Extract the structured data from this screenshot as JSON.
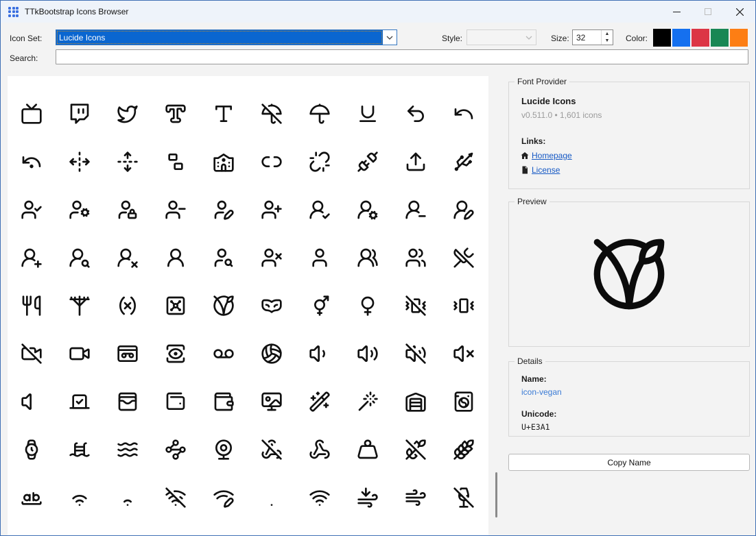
{
  "window": {
    "title": "TTkBootstrap Icons Browser"
  },
  "toolbar": {
    "icon_set_label": "Icon Set:",
    "icon_set_value": "Lucide Icons",
    "style_label": "Style:",
    "style_value": "",
    "size_label": "Size:",
    "size_value": "32",
    "color_label": "Color:",
    "colors": [
      "#000000",
      "#1570ef",
      "#dc3545",
      "#198754",
      "#fd7e14"
    ]
  },
  "search": {
    "label": "Search:",
    "value": "",
    "placeholder": ""
  },
  "grid": {
    "icons": [
      "tv",
      "twitch",
      "twitter",
      "type-outline",
      "type",
      "umbrella-off",
      "umbrella",
      "underline",
      "undo-2",
      "undo",
      "undo-dot",
      "unfold-horizontal",
      "unfold-vertical",
      "ungroup",
      "university",
      "unlink-2",
      "unlink",
      "unplug",
      "upload",
      "usb",
      "user-check",
      "user-cog",
      "user-lock",
      "user-minus",
      "user-pen",
      "user-plus",
      "user-round-check",
      "user-round-cog",
      "user-round-minus",
      "user-round-pen",
      "user-round-plus",
      "user-round-search",
      "user-round-x",
      "user-round",
      "user-search",
      "user-x",
      "user",
      "users-round",
      "users",
      "utensils-crossed",
      "utensils",
      "utility-pole",
      "variable",
      "vault",
      "vegan",
      "venetian-mask",
      "venus-and-mars",
      "venus",
      "vibrate-off",
      "vibrate",
      "video-off",
      "video",
      "videotape",
      "view",
      "voicemail",
      "volleyball",
      "volume-1",
      "volume-2",
      "volume-off",
      "volume-x",
      "volume",
      "vote",
      "wallet-cards",
      "wallet-minimal",
      "wallet",
      "wallpaper",
      "wand-sparkles",
      "wand",
      "warehouse",
      "washing-machine",
      "watch",
      "waves-ladder",
      "waves",
      "waypoints",
      "webcam",
      "webhook-off",
      "webhook",
      "weight",
      "wheat-off",
      "wheat",
      "whole-word",
      "wifi-high",
      "wifi-low",
      "wifi-off",
      "wifi-pen",
      "wifi-zero",
      "wifi",
      "wind-arrow-down",
      "wind",
      "wine-off"
    ]
  },
  "panel": {
    "font_provider": {
      "title": "Font Provider",
      "name": "Lucide Icons",
      "meta": "v0.511.0 • 1,601 icons",
      "links_label": "Links:",
      "links": [
        {
          "icon": "home-icon",
          "label": "Homepage"
        },
        {
          "icon": "license-file-icon",
          "label": "License"
        }
      ]
    },
    "preview": {
      "title": "Preview",
      "icon": "vegan"
    },
    "details": {
      "title": "Details",
      "name_label": "Name:",
      "name_value": "icon-vegan",
      "unicode_label": "Unicode:",
      "unicode_value": "U+E3A1"
    },
    "copy_button": "Copy Name"
  },
  "window_controls": {
    "minimize": "minimize",
    "maximize": "maximize",
    "close": "close"
  }
}
